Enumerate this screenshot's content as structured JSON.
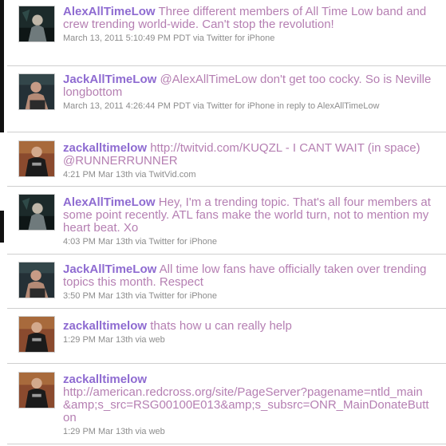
{
  "colors": {
    "username": "#8e6bd1",
    "tweet_text": "#b57fb2",
    "meta_text": "#8c8c8c",
    "divider": "#cfcfcf"
  },
  "tweets": [
    {
      "user": "AlexAllTimeLow",
      "text": "Three different members of All Time Low band and crew trending world-wide. Can't stop the revolution!",
      "meta": "March 13, 2011 5:10:49 PM PDT via Twitter for iPhone",
      "avatar_icon": "alex-avatar-photo"
    },
    {
      "user": "JackAllTimeLow",
      "text": "@AlexAllTimeLow don't get too cocky. So is Neville longbottom",
      "meta": "March 13, 2011 4:26:44 PM PDT via Twitter for iPhone in reply to AlexAllTimeLow",
      "avatar_icon": "jack-avatar-photo"
    },
    {
      "user": "zackalltimelow",
      "text": "http://twitvid.com/KUQZL - I CANT WAIT (in space) @RUNNERRUNNER",
      "meta": "4:21 PM Mar 13th via TwitVid.com",
      "avatar_icon": "zack-avatar-photo"
    },
    {
      "user": "AlexAllTimeLow",
      "text": "Hey, I'm a trending topic. That's all four members at some point recently. ATL fans make the world turn, not to mention my heart beat. Xo",
      "meta": "4:03 PM Mar 13th via Twitter for iPhone",
      "avatar_icon": "alex-avatar-photo"
    },
    {
      "user": "JackAllTimeLow",
      "text": "All time low fans have officially taken over trending topics this month. Respect",
      "meta": "3:50 PM Mar 13th via Twitter for iPhone",
      "avatar_icon": "jack-avatar-photo"
    },
    {
      "user": "zackalltimelow",
      "text": "thats how u can really help",
      "meta": "1:29 PM Mar 13th via web",
      "avatar_icon": "zack-avatar-photo"
    },
    {
      "user": "zackalltimelow",
      "text": "http://american.redcross.org/site/PageServer?pagename=ntld_main&amp;s_src=RSG00100E013&amp;s_subsrc=ONR_MainDonateButton",
      "meta": "1:29 PM Mar 13th via web",
      "avatar_icon": "zack-avatar-photo"
    }
  ]
}
